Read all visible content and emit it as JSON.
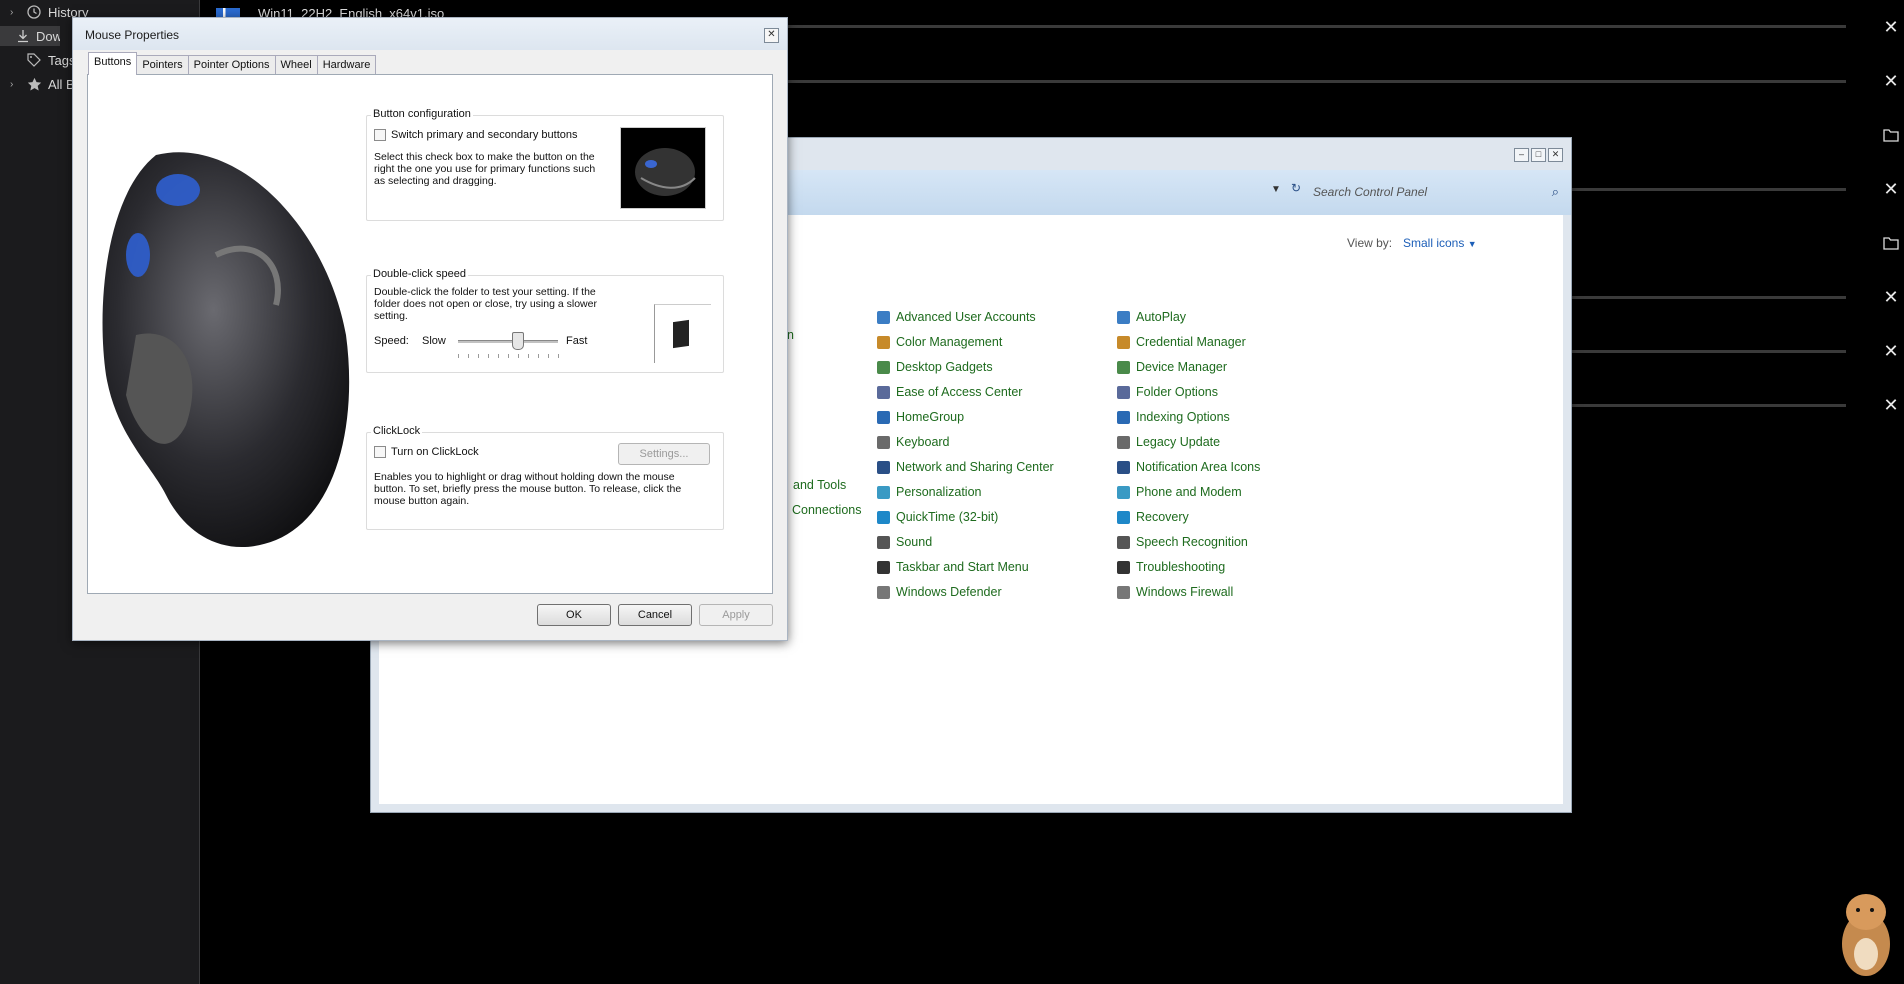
{
  "sidebar": {
    "items": [
      {
        "label": "History",
        "icon": "clock-icon"
      },
      {
        "label": "Down",
        "icon": "download-icon"
      },
      {
        "label": "Tags",
        "icon": "tag-icon"
      },
      {
        "label": "All Bo",
        "icon": "star-icon"
      }
    ]
  },
  "downloads": {
    "top_filename": "Win11_22H2_English_x64v1.iso"
  },
  "control_panel": {
    "search_placeholder": "Search Control Panel",
    "view_by_label": "View by:",
    "view_by_value": "Small icons",
    "partial_items": [
      "n",
      "and Tools",
      "Connections"
    ],
    "col2": [
      "Advanced User Accounts",
      "Color Management",
      "Desktop Gadgets",
      "Ease of Access Center",
      "HomeGroup",
      "Keyboard",
      "Network and Sharing Center",
      "Personalization",
      "QuickTime (32-bit)",
      "Sound",
      "Taskbar and Start Menu",
      "Windows Defender"
    ],
    "col3": [
      "AutoPlay",
      "Credential Manager",
      "Device Manager",
      "Folder Options",
      "Indexing Options",
      "Legacy Update",
      "Notification Area Icons",
      "Phone and Modem",
      "Recovery",
      "Speech Recognition",
      "Troubleshooting",
      "Windows Firewall"
    ]
  },
  "mouse_dialog": {
    "title": "Mouse Properties",
    "tabs": [
      "Buttons",
      "Pointers",
      "Pointer Options",
      "Wheel",
      "Hardware"
    ],
    "button_config": {
      "title": "Button configuration",
      "checkbox_label": "Switch primary and secondary buttons",
      "description": "Select this check box to make the button on the right the one you use for primary functions such as selecting and dragging."
    },
    "double_click": {
      "title": "Double-click speed",
      "description": "Double-click the folder to test your setting. If the folder does not open or close, try using a slower setting.",
      "speed_label": "Speed:",
      "slow_label": "Slow",
      "fast_label": "Fast",
      "speed_fraction": 0.6
    },
    "clicklock": {
      "title": "ClickLock",
      "checkbox_label": "Turn on ClickLock",
      "settings_button": "Settings...",
      "description": "Enables you to highlight or drag without holding down the mouse button. To set, briefly press the mouse button. To release, click the mouse button again."
    },
    "buttons": {
      "ok": "OK",
      "cancel": "Cancel",
      "apply": "Apply"
    }
  },
  "colors": {
    "link_green": "#1e6b1e",
    "accent_blue": "#1d5fb8"
  }
}
